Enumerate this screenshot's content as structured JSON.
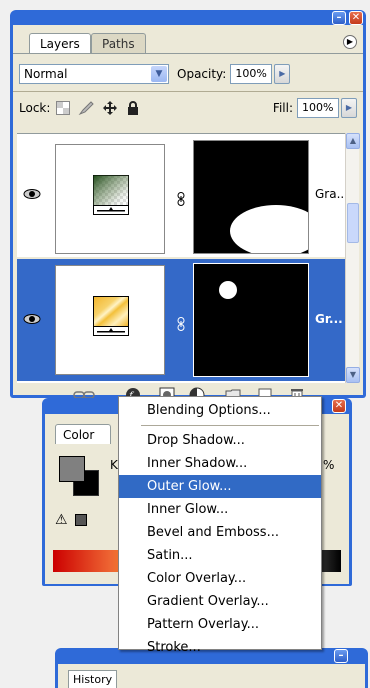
{
  "layers_panel": {
    "tabs": [
      "Layers",
      "Paths"
    ],
    "blend_mode": "Normal",
    "opacity_label": "Opacity:",
    "opacity_value": "100%",
    "lock_label": "Lock:",
    "fill_label": "Fill:",
    "fill_value": "100%",
    "layers": [
      {
        "name": "Gra...",
        "visible": true,
        "selected": false
      },
      {
        "name": "Gr...",
        "visible": true,
        "selected": true
      }
    ]
  },
  "color_panel": {
    "tab": "Color",
    "channel_label": "K",
    "channel_unit": "%"
  },
  "history_panel": {
    "tab": "History"
  },
  "context_menu": {
    "items": [
      "Blending Options...",
      "Drop Shadow...",
      "Inner Shadow...",
      "Outer Glow...",
      "Inner Glow...",
      "Bevel and Emboss...",
      "Satin...",
      "Color Overlay...",
      "Gradient Overlay...",
      "Pattern Overlay...",
      "Stroke..."
    ],
    "highlighted_index": 3
  },
  "colors": {
    "titlebar": "#2f6ad8",
    "selection": "#3469c8",
    "menu_highlight": "#316ac5",
    "panel_bg": "#ece9d8"
  }
}
